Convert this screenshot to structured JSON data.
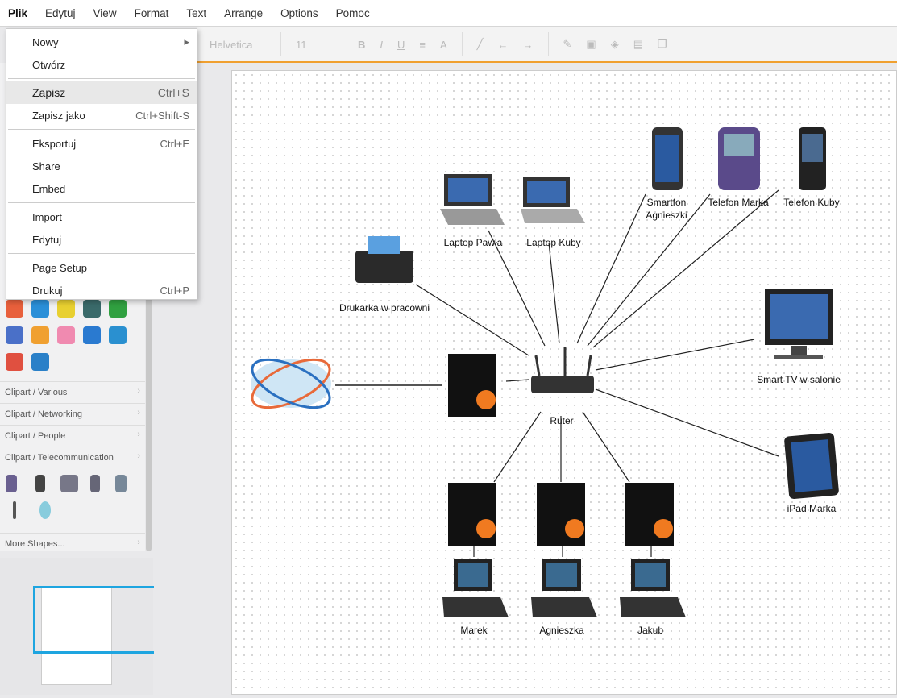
{
  "menubar": [
    "Plik",
    "Edytuj",
    "View",
    "Format",
    "Text",
    "Arrange",
    "Options",
    "Pomoc"
  ],
  "toolbar": {
    "font": "Helvetica",
    "size": "11",
    "bold": "B",
    "italic": "I",
    "underline": "U",
    "align": "≡",
    "color": "A"
  },
  "file_menu": [
    {
      "label": "Nowy",
      "shortcut": "▸"
    },
    {
      "label": "Otwórz",
      "shortcut": ""
    },
    {
      "label": "Zapisz",
      "shortcut": "Ctrl+S"
    },
    {
      "label": "Zapisz jako",
      "shortcut": "Ctrl+Shift-S"
    },
    {
      "label": "Eksportuj",
      "shortcut": "Ctrl+E"
    },
    {
      "label": "Share",
      "shortcut": ""
    },
    {
      "label": "Embed",
      "shortcut": ""
    },
    {
      "label": "Import",
      "shortcut": ""
    },
    {
      "label": "Edytuj",
      "shortcut": ""
    },
    {
      "label": "Page Setup",
      "shortcut": ""
    },
    {
      "label": "Drukuj",
      "shortcut": "Ctrl+P"
    }
  ],
  "sidebar": {
    "categories": [
      "Clipart / Various",
      "Clipart / Networking",
      "Clipart / People",
      "Clipart / Telecommunication"
    ],
    "more": "More Shapes..."
  },
  "diagram": {
    "router": "Ruter",
    "printer": "Drukarka w pracowni",
    "laptop1": "Laptop Pawła",
    "laptop2": "Laptop Kuby",
    "phone1_l1": "Smartfon",
    "phone1_l2": "Agnieszki",
    "phone2": "Telefon Marka",
    "phone3": "Telefon Kuby",
    "tv": "Smart TV w salonie",
    "ipad": "iPad Marka",
    "pc1": "Marek",
    "pc2": "Agnieszka",
    "pc3": "Jakub"
  },
  "colors": {
    "accent": "#f0a030",
    "selection": "#1ea5e0"
  }
}
